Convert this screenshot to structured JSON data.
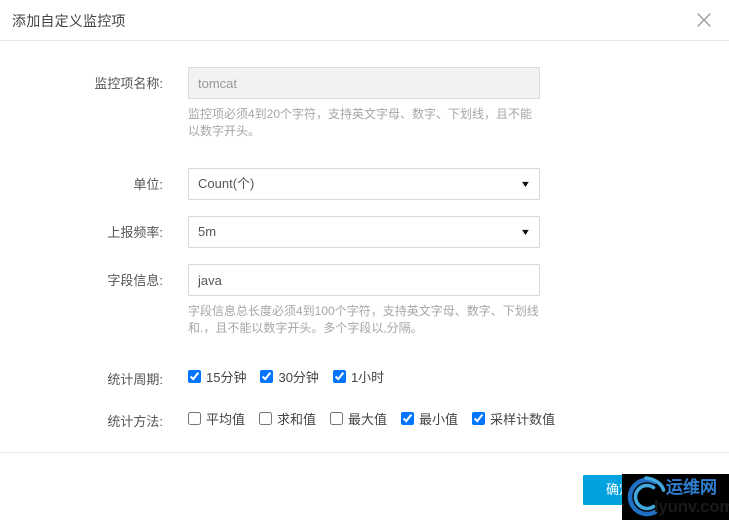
{
  "dialog": {
    "title": "添加自定义监控项",
    "close_icon": "close-icon"
  },
  "form": {
    "name": {
      "label": "监控项名称:",
      "value": "tomcat",
      "placeholder": "",
      "hint": "监控项必须4到20个字符，支持英文字母、数字、下划线，且不能以数字开头。"
    },
    "unit": {
      "label": "单位:",
      "value": "Count(个)",
      "options": [
        "Count(个)"
      ],
      "arrow_icon": "chevron-down-icon"
    },
    "frequency": {
      "label": "上报频率:",
      "value": "5m",
      "options": [
        "5m"
      ],
      "arrow_icon": "chevron-down-icon"
    },
    "field_info": {
      "label": "字段信息:",
      "value": "java",
      "placeholder": "",
      "hint": "字段信息总长度必须4到100个字符，支持英文字母、数字、下划线和.，且不能以数字开头。多个字段以,分隔。"
    },
    "period": {
      "label": "统计周期:",
      "items": [
        {
          "label": "15分钟",
          "checked": true
        },
        {
          "label": "30分钟",
          "checked": true
        },
        {
          "label": "1小时",
          "checked": true
        }
      ]
    },
    "method": {
      "label": "统计方法:",
      "items": [
        {
          "label": "平均值",
          "checked": false
        },
        {
          "label": "求和值",
          "checked": false
        },
        {
          "label": "最大值",
          "checked": false
        },
        {
          "label": "最小值",
          "checked": true
        },
        {
          "label": "采样计数值",
          "checked": true
        }
      ]
    }
  },
  "footer": {
    "ok_label": "确定"
  },
  "watermark": {
    "cn": "运维网",
    "en": "lyunv.com"
  },
  "colors": {
    "accent": "#00a2e0",
    "border": "#d9d9d9",
    "divider": "#e6e6e6",
    "hint_text": "#a6a6a6",
    "label_text": "#555555",
    "watermark_blue": "#2f7fd0"
  }
}
